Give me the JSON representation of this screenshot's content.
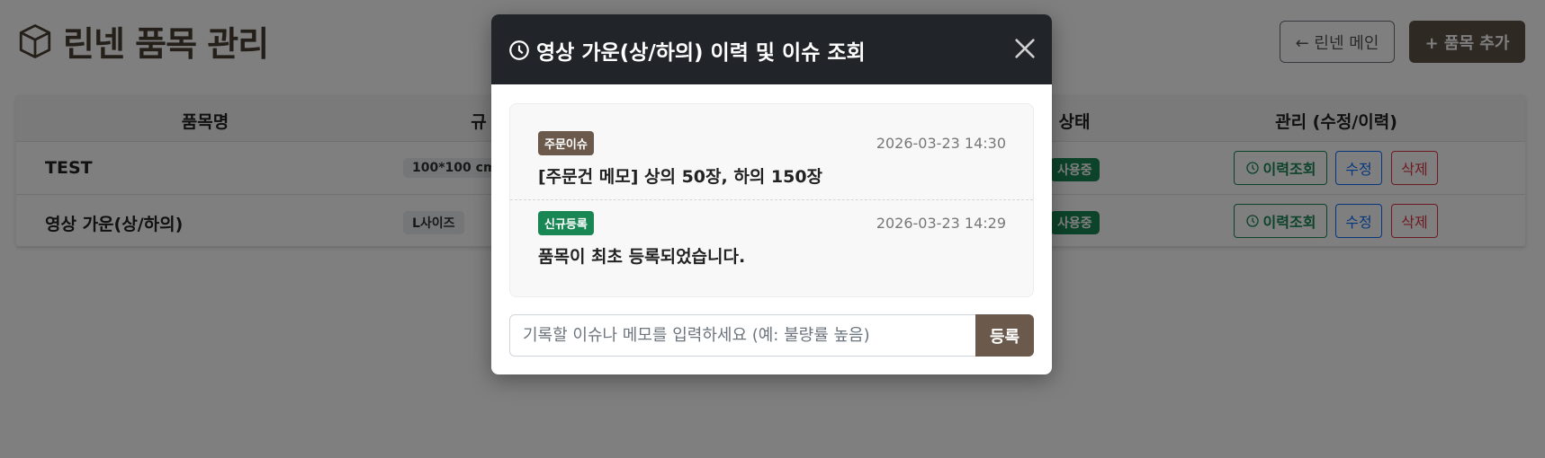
{
  "page": {
    "title": "린넨 품목 관리",
    "back_button": "← 린넨 메인",
    "add_button": "+ 품목 추가"
  },
  "table": {
    "headers": {
      "name": "품목명",
      "spec": "규",
      "status": "상태",
      "manage": "관리 (수정/이력)"
    },
    "rows": [
      {
        "name": "TEST",
        "spec": "100*100 cm",
        "status": "사용중",
        "history": "이력조회",
        "edit": "수정",
        "delete": "삭제"
      },
      {
        "name": "영상 가운(상/하의)",
        "spec": "L사이즈",
        "status": "사용중",
        "history": "이력조회",
        "edit": "수정",
        "delete": "삭제"
      }
    ]
  },
  "modal": {
    "title": "영상 가운(상/하의) 이력 및 이슈 조회",
    "entries": [
      {
        "tag": "주문이슈",
        "timestamp": "2026-03-23 14:30",
        "text": "[주문건 메모] 상의 50장, 하의 150장"
      },
      {
        "tag": "신규등록",
        "timestamp": "2026-03-23 14:29",
        "text": "품목이 최초 등록되었습니다."
      }
    ],
    "input_placeholder": "기록할 이슈나 메모를 입력하세요 (예: 불량률 높음)",
    "submit_label": "등록"
  },
  "colors": {
    "brand_brown": "#5e5246",
    "header_dark": "#212529",
    "success_green": "#198754",
    "primary_blue": "#0d6efd",
    "danger_red": "#dc3545"
  }
}
